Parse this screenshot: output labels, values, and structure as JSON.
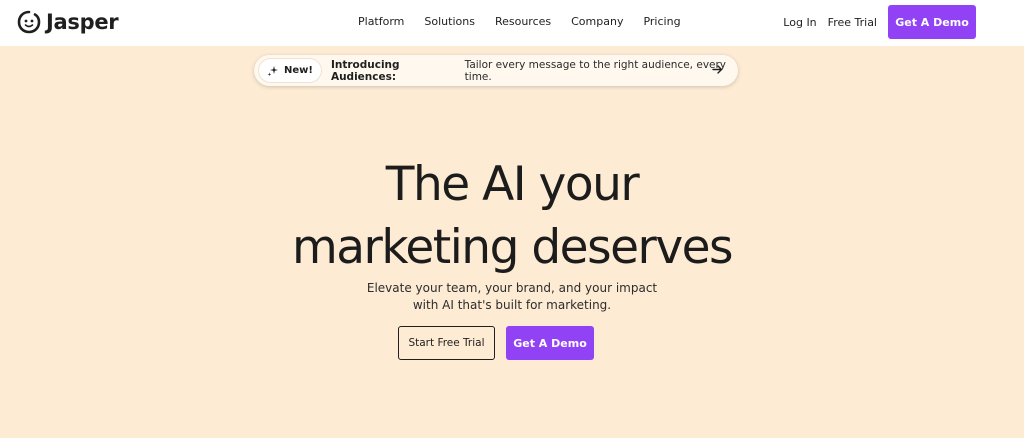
{
  "brand": {
    "name": "Jasper",
    "logo_icon": "jasper-face-logo"
  },
  "nav": {
    "links": [
      "Platform",
      "Solutions",
      "Resources",
      "Company",
      "Pricing"
    ],
    "login": "Log In",
    "free_trial": "Free Trial",
    "demo": "Get A Demo"
  },
  "announcement": {
    "badge": "New!",
    "badge_icon": "sparkle-icon",
    "title": "Introducing Audiences:",
    "text": "Tailor every message to the right audience, every time.",
    "arrow_icon": "arrow-right-icon"
  },
  "hero": {
    "title_line1": "The AI your",
    "title_line2": "marketing deserves",
    "subtitle_line1": "Elevate your team, your brand, and your impact",
    "subtitle_line2": "with AI that's built for marketing.",
    "cta_trial": "Start Free Trial",
    "cta_demo": "Get A Demo"
  },
  "colors": {
    "background": "#fdebd3",
    "accent": "#9142f5",
    "nav_background": "#ffffff"
  }
}
